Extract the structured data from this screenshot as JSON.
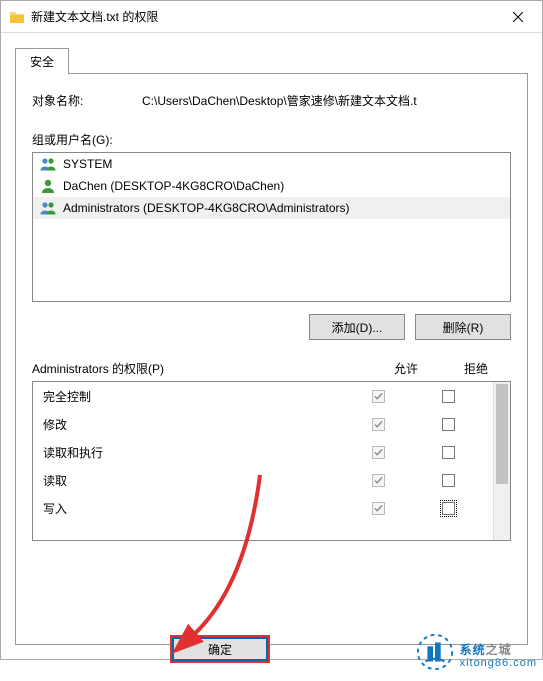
{
  "title": "新建文本文档.txt 的权限",
  "tab_label": "安全",
  "object": {
    "label": "对象名称:",
    "value": "C:\\Users\\DaChen\\Desktop\\管家速修\\新建文本文档.t"
  },
  "groups_label": "组或用户名(G):",
  "users": [
    {
      "name": "SYSTEM",
      "icon": "users",
      "selected": false
    },
    {
      "name": "DaChen (DESKTOP-4KG8CRO\\DaChen)",
      "icon": "user",
      "selected": false
    },
    {
      "name": "Administrators (DESKTOP-4KG8CRO\\Administrators)",
      "icon": "users",
      "selected": true
    }
  ],
  "buttons": {
    "add": "添加(D)...",
    "remove": "删除(R)"
  },
  "perm": {
    "label": "Administrators 的权限(P)",
    "col_allow": "允许",
    "col_deny": "拒绝",
    "rows": [
      {
        "name": "完全控制",
        "allow": true,
        "deny": false,
        "deny_focus": false
      },
      {
        "name": "修改",
        "allow": true,
        "deny": false,
        "deny_focus": false
      },
      {
        "name": "读取和执行",
        "allow": true,
        "deny": false,
        "deny_focus": false
      },
      {
        "name": "读取",
        "allow": true,
        "deny": false,
        "deny_focus": false
      },
      {
        "name": "写入",
        "allow": true,
        "deny": false,
        "deny_focus": true
      }
    ]
  },
  "ok_label": "确定",
  "watermark": {
    "cn1": "系统",
    "cn2": "之城",
    "en": "xitong86.com"
  }
}
